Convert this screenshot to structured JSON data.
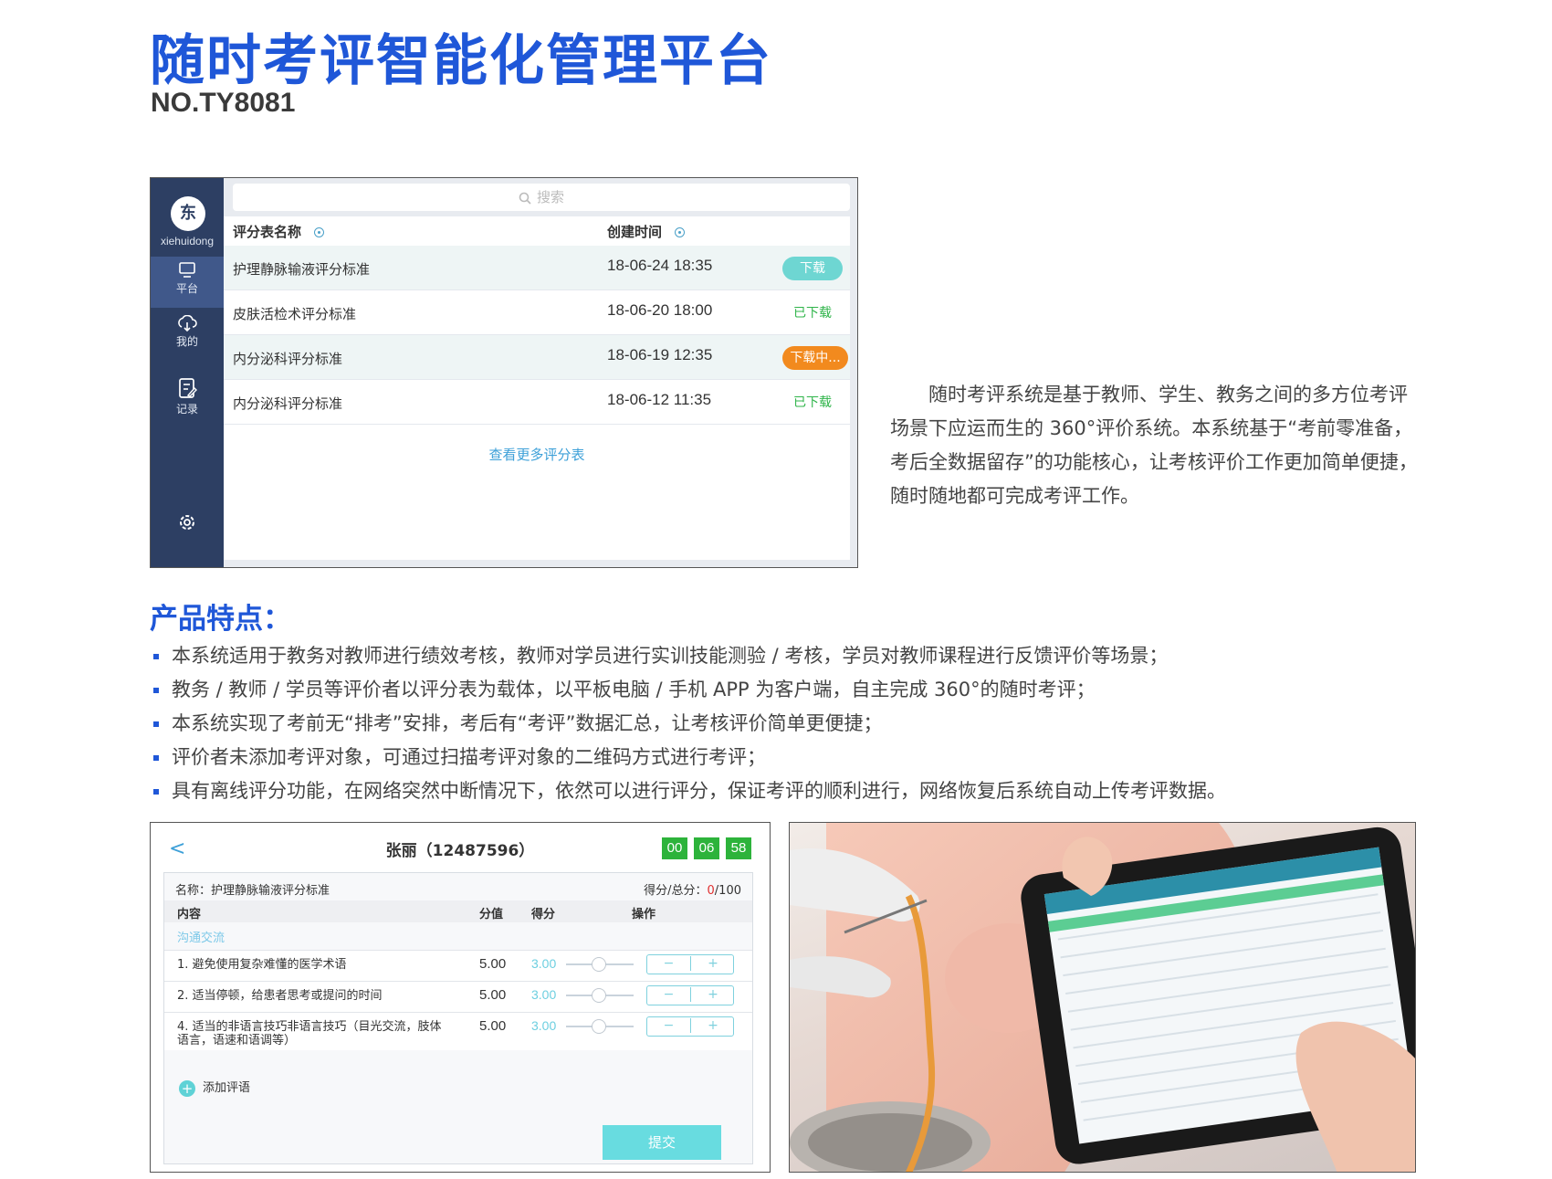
{
  "header": {
    "title": "随时考评智能化管理平台",
    "model_no": "NO.TY8081"
  },
  "screen1": {
    "user": {
      "avatar_char": "东",
      "name": "xiehuidong"
    },
    "nav": [
      {
        "label": "平台",
        "icon": "monitor-icon"
      },
      {
        "label": "我的",
        "icon": "cloud-download-icon"
      },
      {
        "label": "记录",
        "icon": "record-icon"
      }
    ],
    "search_placeholder": "搜索",
    "columns": {
      "name": "评分表名称",
      "created": "创建时间"
    },
    "rows": [
      {
        "name": "护理静脉输液评分标准",
        "created": "18-06-24  18:35",
        "status": "下载"
      },
      {
        "name": "皮肤活检术评分标准",
        "created": "18-06-20 18:00",
        "status": "已下载"
      },
      {
        "name": "内分泌科评分标准",
        "created": "18-06-19  12:35",
        "status": "下载中..."
      },
      {
        "name": "内分泌科评分标准",
        "created": "18-06-12  11:35",
        "status": "已下载"
      }
    ],
    "more_link": "查看更多评分表"
  },
  "description": "随时考评系统是基于教师、学生、教务之间的多方位考评场景下应运而生的 360°评价系统。本系统基于“考前零准备，考后全数据留存”的功能核心，让考核评价工作更加简单便捷，随时随地都可完成考评工作。",
  "features": {
    "title": "产品特点：",
    "items": [
      "本系统适用于教务对教师进行绩效考核，教师对学员进行实训技能测验 / 考核，学员对教师课程进行反馈评价等场景；",
      "教务 / 教师 / 学员等评价者以评分表为载体，以平板电脑 / 手机 APP 为客户端，自主完成 360°的随时考评；",
      "本系统实现了考前无“排考”安排，考后有“考评”数据汇总，让考核评价简单更便捷；",
      "评价者未添加考评对象，可通过扫描考评对象的二维码方式进行考评；",
      "具有离线评分功能，在网络突然中断情况下，依然可以进行评分，保证考评的顺利进行，网络恢复后系统自动上传考评数据。"
    ]
  },
  "screen2": {
    "back": "<",
    "title": "张丽（12487596）",
    "timer": [
      "00",
      "06",
      "58"
    ],
    "form_name": "名称：护理静脉输液评分标准",
    "score_label": "得分/总分：",
    "score_value": "0",
    "score_total": "/100",
    "columns": {
      "content": "内容",
      "value": "分值",
      "got": "得分",
      "action": "操作"
    },
    "section": "沟通交流",
    "items": [
      {
        "text": "1. 避免使用复杂难懂的医学术语",
        "value": "5.00",
        "got": "3.00"
      },
      {
        "text": "2. 适当停顿，给患者思考或提问的时间",
        "value": "5.00",
        "got": "3.00"
      },
      {
        "text": "4. 适当的非语言技巧非语言技巧（目光交流，肢体语言，语速和语调等）",
        "value": "5.00",
        "got": "3.00"
      }
    ],
    "minus": "−",
    "plus": "+",
    "add_comment": "添加评语",
    "submit": "提交"
  },
  "colors": {
    "brand_blue": "#1f57d8",
    "sidebar": "#2d3f63",
    "download": "#6ed6d2",
    "downloaded": "#2fb44a",
    "downloading": "#f28a1e",
    "timer": "#2db33b"
  }
}
